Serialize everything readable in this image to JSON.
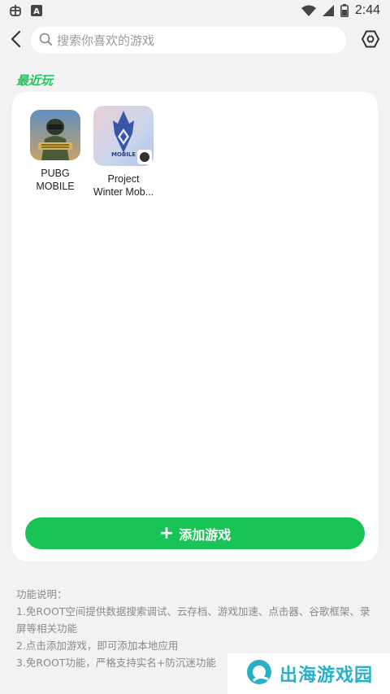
{
  "status_bar": {
    "left_icons": [
      "bug-icon",
      "font-a-icon"
    ],
    "right_icons": [
      "wifi-icon",
      "cell-signal-icon",
      "battery-icon"
    ],
    "time": "2:44"
  },
  "top_bar": {
    "search_placeholder": "搜索你喜欢的游戏",
    "back_icon": "chevron-left-icon",
    "settings_icon": "gear-icon"
  },
  "recent": {
    "title": "最近玩",
    "games": [
      {
        "name_line1": "PUBG",
        "name_line2": "MOBILE",
        "icon": "pubg-mobile-icon"
      },
      {
        "name_line1": "Project",
        "name_line2": "Winter Mob...",
        "icon": "project-winter-icon"
      }
    ]
  },
  "add_button": {
    "label": "添加游戏",
    "icon": "plus-icon"
  },
  "notes": {
    "heading": "功能说明：",
    "line1": "1.免ROOT空间提供数据搜索调试、云存档、游戏加速、点击器、谷歌框架、录",
    "line1b": "屏等相关功能",
    "line2": "2.点击添加游戏，即可添加本地应用",
    "line3": "3.免ROOT功能，严格支持实名+防沉迷功能"
  },
  "watermark": {
    "text": "出海游戏园"
  },
  "colors": {
    "accent_green": "#19c457",
    "section_title": "#1fc85a",
    "background": "#f2f2f4",
    "watermark": "#27b0c8"
  }
}
